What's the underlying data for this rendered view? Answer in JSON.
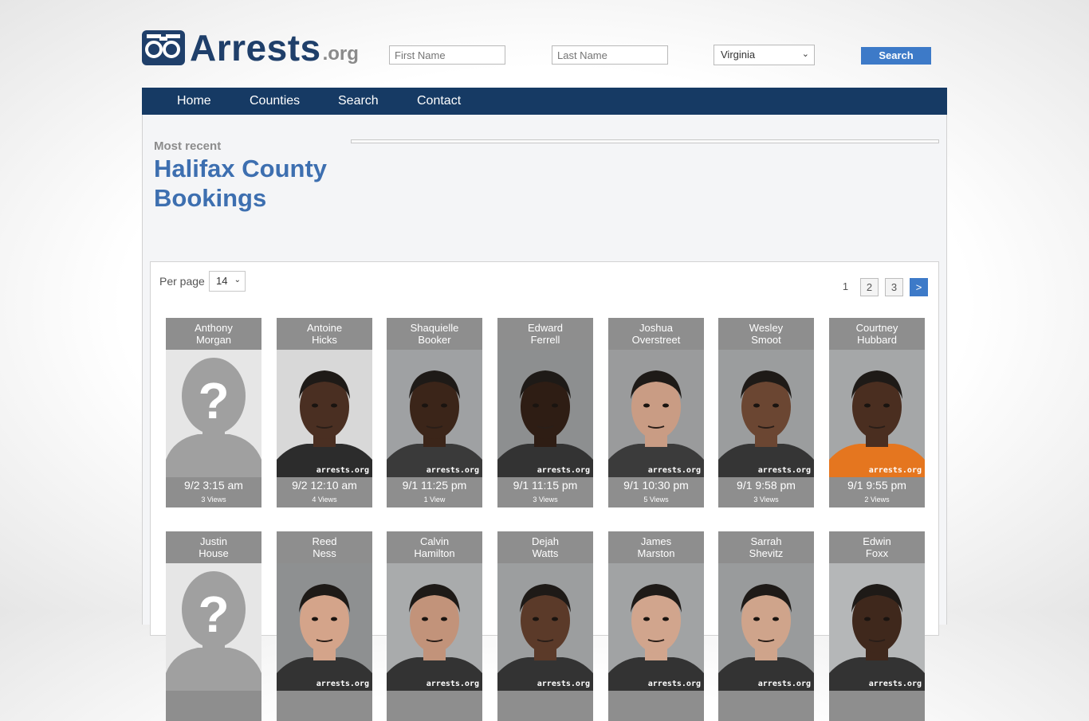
{
  "brand": {
    "name": "Arrests",
    "tld": ".org"
  },
  "search": {
    "first_placeholder": "First Name",
    "last_placeholder": "Last Name",
    "state": "Virginia",
    "button": "Search"
  },
  "nav": {
    "home": "Home",
    "counties": "Counties",
    "search": "Search",
    "contact": "Contact"
  },
  "page": {
    "kicker": "Most recent",
    "title": "Halifax County Bookings"
  },
  "list": {
    "per_page_label": "Per page",
    "per_page_value": "14",
    "pagination": {
      "current": "1",
      "p2": "2",
      "p3": "3",
      "next": ">"
    }
  },
  "bookings": [
    {
      "first": "Anthony",
      "last": "Morgan",
      "time": "9/2 3:15 am",
      "views": "3 Views",
      "photo": "placeholder",
      "skin": "#ffffff",
      "bg": "#e8e8e8",
      "shirt": "#2a2a2a"
    },
    {
      "first": "Antoine",
      "last": "Hicks",
      "time": "9/2 12:10 am",
      "views": "4 Views",
      "photo": "mugshot",
      "skin": "#4a2f22",
      "bg": "#d8d8d8",
      "shirt": "#2c2c2c"
    },
    {
      "first": "Shaquielle",
      "last": "Booker",
      "time": "9/1 11:25 pm",
      "views": "1 View",
      "photo": "mugshot",
      "skin": "#3b2519",
      "bg": "#9fa1a3",
      "shirt": "#3a3a3a"
    },
    {
      "first": "Edward",
      "last": "Ferrell",
      "time": "9/1 11:15 pm",
      "views": "3 Views",
      "photo": "mugshot",
      "skin": "#2e1d14",
      "bg": "#8d8f90",
      "shirt": "#333333"
    },
    {
      "first": "Joshua",
      "last": "Overstreet",
      "time": "9/1 10:30 pm",
      "views": "5 Views",
      "photo": "mugshot",
      "skin": "#c99c84",
      "bg": "#9a9b9c",
      "shirt": "#3b3b3b"
    },
    {
      "first": "Wesley",
      "last": "Smoot",
      "time": "9/1 9:58 pm",
      "views": "3 Views",
      "photo": "mugshot",
      "skin": "#6b4632",
      "bg": "#9b9d9e",
      "shirt": "#353535"
    },
    {
      "first": "Courtney",
      "last": "Hubbard",
      "time": "9/1 9:55 pm",
      "views": "2 Views",
      "photo": "mugshot",
      "skin": "#4a2e20",
      "bg": "#a5a7a8",
      "shirt": "#e5761f"
    },
    {
      "first": "Justin",
      "last": "House",
      "time": "",
      "views": "",
      "photo": "placeholder",
      "skin": "#ffffff",
      "bg": "#e8e8e8",
      "shirt": "#2a2a2a"
    },
    {
      "first": "Reed",
      "last": "Ness",
      "time": "",
      "views": "",
      "photo": "mugshot",
      "skin": "#d4a48a",
      "bg": "#8e9091",
      "shirt": "#333333"
    },
    {
      "first": "Calvin",
      "last": "Hamilton",
      "time": "",
      "views": "",
      "photo": "mugshot",
      "skin": "#c2937a",
      "bg": "#a9abac",
      "shirt": "#333333"
    },
    {
      "first": "Dejah",
      "last": "Watts",
      "time": "",
      "views": "",
      "photo": "mugshot",
      "skin": "#5b3a29",
      "bg": "#9c9e9f",
      "shirt": "#333333"
    },
    {
      "first": "James",
      "last": "Marston",
      "time": "",
      "views": "",
      "photo": "mugshot",
      "skin": "#d1a58d",
      "bg": "#a1a3a4",
      "shirt": "#333333"
    },
    {
      "first": "Sarrah",
      "last": "Shevitz",
      "time": "",
      "views": "",
      "photo": "mugshot",
      "skin": "#cfa48b",
      "bg": "#999b9c",
      "shirt": "#333333"
    },
    {
      "first": "Edwin",
      "last": "Foxx",
      "time": "",
      "views": "",
      "photo": "mugshot",
      "skin": "#3f281c",
      "bg": "#b5b7b8",
      "shirt": "#333333"
    }
  ],
  "watermark": "arrests.org",
  "colors": {
    "nav": "#163a64",
    "accent": "#3d7ac8",
    "title": "#3d6fb0",
    "card": "#8e8e8e"
  }
}
